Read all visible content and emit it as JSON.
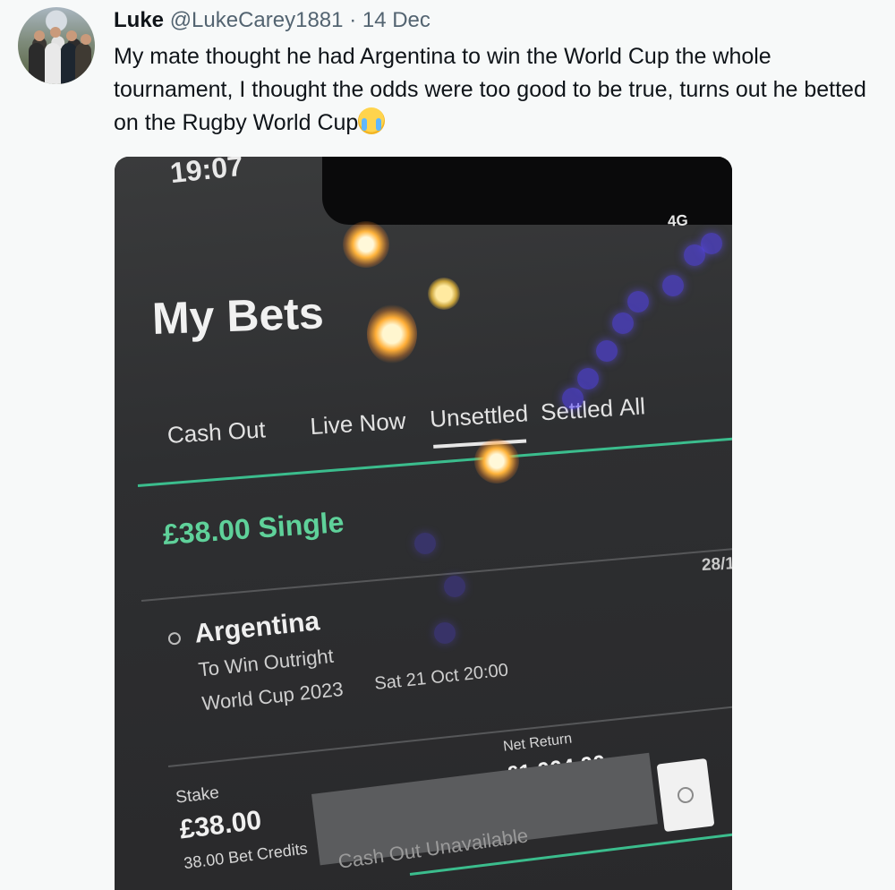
{
  "tweet": {
    "author_name": "Luke",
    "author_handle": "@LukeCarey1881",
    "separator": "·",
    "date": "14 Dec",
    "text": "My mate thought he had Argentina to win the World Cup the whole tournament, I thought the odds were too good to be true, turns out he betted on the Rugby World Cup",
    "emoji_icon": "loudly-crying-face-icon"
  },
  "photo": {
    "status_time": "19:07",
    "network": "4G",
    "screen_title": "My Bets",
    "tabs": [
      "Cash Out",
      "Live Now",
      "Unsettled",
      "Settled",
      "All"
    ],
    "active_tab": "Unsettled",
    "bet_title": "£38.00 Single",
    "odds": "28/1",
    "selection": "Argentina",
    "market": "To Win Outright",
    "event": "World Cup 2023",
    "event_date": "Sat 21 Oct 20:00",
    "stake_label": "Stake",
    "stake_value": "£38.00",
    "bet_credits": "38.00 Bet Credits",
    "net_return_label": "Net Return",
    "net_return_value": "£1,064.00",
    "cash_out_label": "Cash Out Unavailable",
    "accent_color": "#3bbd8d"
  }
}
